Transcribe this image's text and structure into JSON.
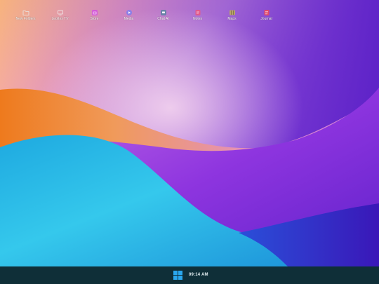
{
  "desktop": {
    "icons": [
      {
        "label": "New Folders",
        "icon": "folder-icon",
        "color": "#d9d9d9"
      },
      {
        "label": "Leottex TV",
        "icon": "tv-icon",
        "color": "#f2f2f2"
      },
      {
        "label": "Store",
        "icon": "store-icon",
        "color": "#d45ad8"
      },
      {
        "label": "Media",
        "icon": "media-icon",
        "color": "#8a7fe8"
      },
      {
        "label": "Chat AI",
        "icon": "chat-icon",
        "color": "#6a82a8"
      },
      {
        "label": "Notes",
        "icon": "notes-icon",
        "color": "#e05a8c"
      },
      {
        "label": "Maps",
        "icon": "map-icon",
        "color": "#b9a46a"
      },
      {
        "label": "Journal",
        "icon": "journal-icon",
        "color": "#e04a6a"
      }
    ]
  },
  "taskbar": {
    "clock": "09:14 AM",
    "start_icon": "windows-start-icon",
    "background": "#0f2f38",
    "accent": "#2aa7ee"
  }
}
